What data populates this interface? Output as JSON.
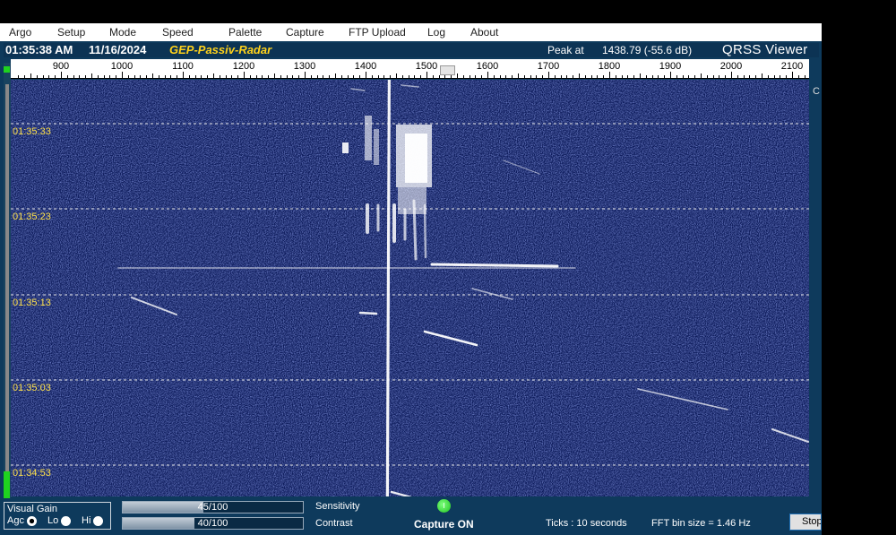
{
  "menu": [
    "Argo",
    "Setup",
    "Mode",
    "Speed",
    "Palette",
    "Capture",
    "FTP Upload",
    "Log",
    "About"
  ],
  "info": {
    "time": "01:35:38 AM",
    "date": "11/16/2024",
    "station": "GEP-Passiv-Radar",
    "peak_label": "Peak at",
    "peak_value": "1438.79 (-55.6 dB)",
    "app_title": "QRSS Viewer"
  },
  "ruler": {
    "labels": [
      "900",
      "1000",
      "1100",
      "1200",
      "1300",
      "1400",
      "1500",
      "1600",
      "1700",
      "1800",
      "1900",
      "2000",
      "2100"
    ]
  },
  "waterfall": {
    "time_labels": [
      "01:35:33",
      "01:35:23",
      "01:35:13",
      "01:35:03",
      "01:34:53"
    ],
    "peak_frequency_hz": 1438.79,
    "right_edge_text": "C"
  },
  "colors": {
    "waterfall_background": "#0c1a5a",
    "timestamp": "#ffe14a",
    "station": "#ffd21a",
    "status_green": "#1fd31f"
  },
  "controls": {
    "visual_gain_title": "Visual Gain",
    "agc_label": "Agc",
    "lo_label": "Lo",
    "hi_label": "Hi",
    "agc_selected": true,
    "sensitivity_value": "45/100",
    "sensitivity_fraction": 0.45,
    "sensitivity_label": "Sensitivity",
    "contrast_value": "40/100",
    "contrast_fraction": 0.4,
    "contrast_label": "Contrast",
    "capture_indicator_text": "I",
    "capture_status": "Capture ON",
    "ticks_text": "Ticks  : 10 seconds",
    "fft_text": "FFT bin size = 1.46 Hz",
    "stop_label": "Stop"
  }
}
